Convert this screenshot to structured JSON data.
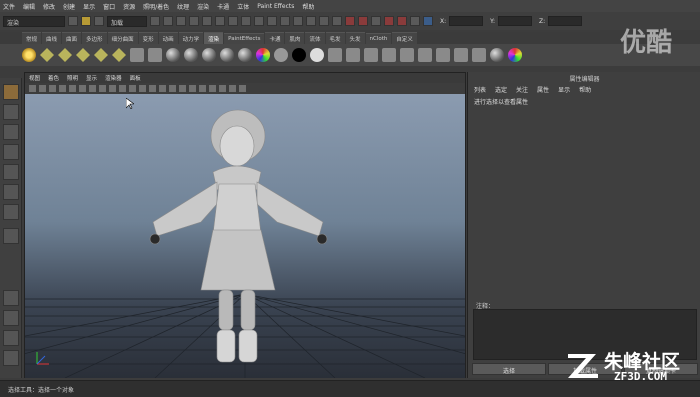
{
  "menubar": [
    "文件",
    "编辑",
    "修改",
    "创建",
    "显示",
    "窗口",
    "资源",
    "照明/着色",
    "纹理",
    "渲染",
    "卡通",
    "立体",
    "Paint Effects",
    "帮助"
  ],
  "status": {
    "mode": "渲染",
    "layer_label": "加载",
    "x_label": "X:",
    "y_label": "Y:",
    "z_label": "Z:"
  },
  "shelf_tabs": [
    "常规",
    "曲线",
    "曲面",
    "多边形",
    "细分曲面",
    "变形",
    "动画",
    "动力学",
    "渲染",
    "PaintEffects",
    "卡通",
    "肌肉",
    "流体",
    "毛发",
    "头发",
    "nCloth",
    "自定义"
  ],
  "shelf_active_index": 8,
  "view_menu": [
    "视图",
    "着色",
    "照明",
    "显示",
    "渲染器",
    "面板"
  ],
  "attr_editor": {
    "title": "属性编辑器",
    "menus": [
      "列表",
      "选定",
      "关注",
      "属性",
      "显示",
      "帮助"
    ],
    "hint": "进行选择以查看属性",
    "notes_label": "注释：",
    "buttons": [
      "选择",
      "加载属性",
      "复制选项卡"
    ]
  },
  "helpline": "选择工具：选择一个对象",
  "watermarks": {
    "top": "优酷",
    "site_cn": "朱峰社区",
    "site_url": "ZF3D.COM"
  }
}
